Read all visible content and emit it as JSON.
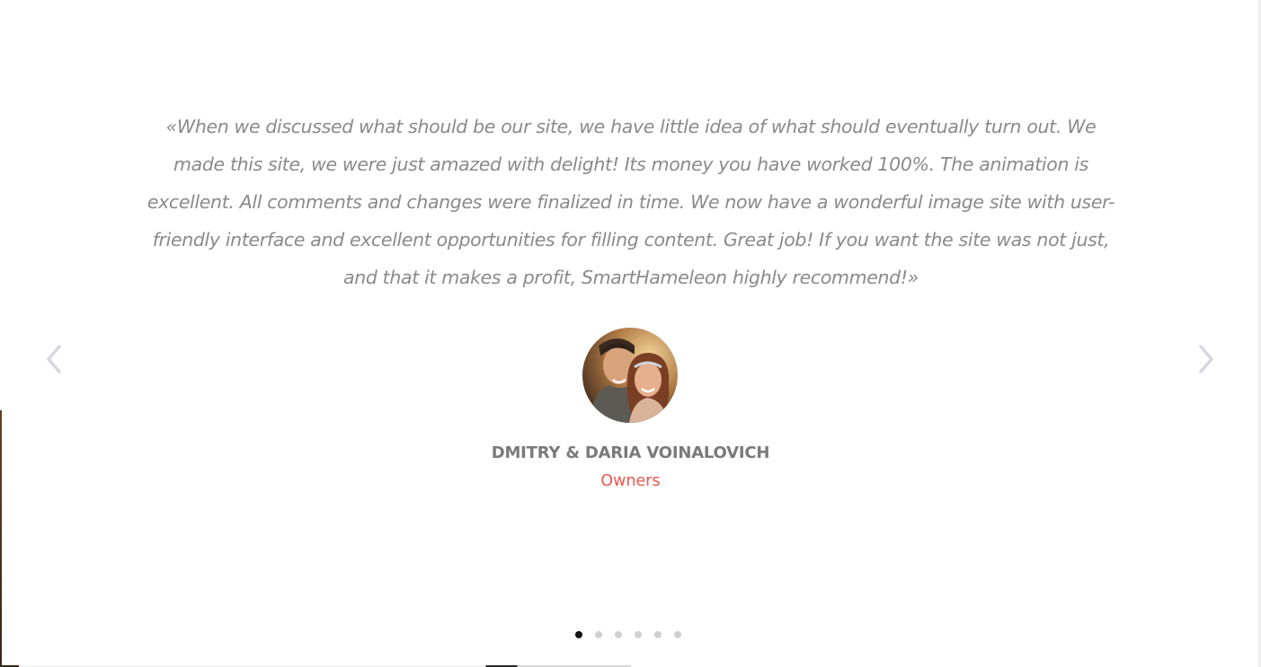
{
  "testimonial": {
    "quote": "«When we discussed what should be our site, we have little idea of what should eventually turn out. We made this site, we were just amazed with delight! Its money you have worked 100%. The animation is excellent. All comments and changes were finalized in time. We now have a wonderful image site with user-friendly interface and excellent opportunities for filling content. Great job! If you want the site was not just, and that it makes a profit, SmartHameleon highly recommend!»",
    "author_name": "DMITRY & DARIA VOINALOVICH",
    "author_role": "Owners",
    "avatar_icon": "couple-photo-avatar"
  },
  "navigation": {
    "prev_icon": "chevron-left-icon",
    "next_icon": "chevron-right-icon"
  },
  "pagination": {
    "total": 6,
    "active_index": 0
  },
  "colors": {
    "quote_text": "#8a8a8a",
    "author_name": "#7a7a7a",
    "author_role": "#e8574e",
    "arrow": "#d7d7e0",
    "dot_active": "#111111",
    "dot_inactive": "#d0d0d0"
  }
}
